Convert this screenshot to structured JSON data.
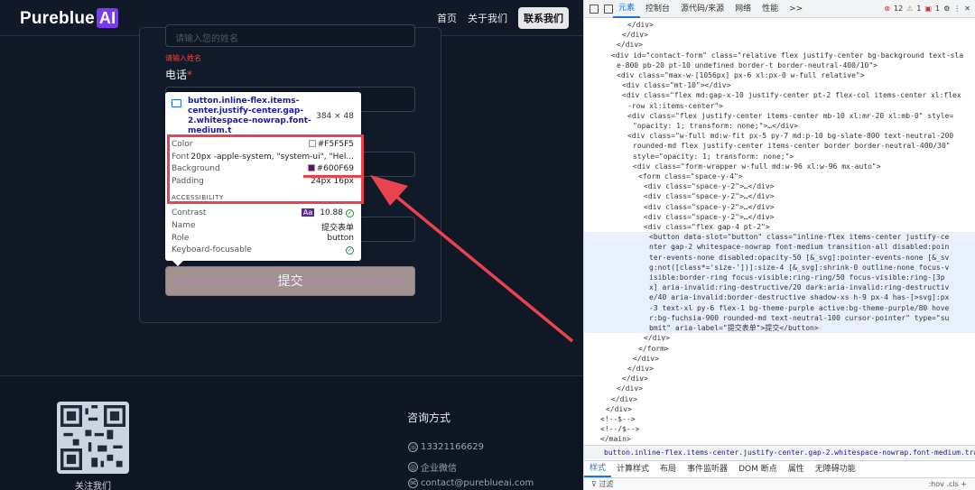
{
  "site": {
    "logo_text": "Pureblue",
    "logo_ai": "AI",
    "nav": {
      "home": "首页",
      "about": "关于我们",
      "contact": "联系我们"
    },
    "form": {
      "name_placeholder": "请输入您的姓名",
      "name_error": "请输入姓名",
      "phone_label": "电话",
      "required_mark": "*",
      "submit_label": "提交"
    },
    "footer": {
      "follow": "关注我们",
      "contact_title": "咨询方式",
      "phone": "13321166629",
      "wechat": "企业微信",
      "email": "contact@pureblueai.com"
    }
  },
  "inspector_tooltip": {
    "selector": "button.inline-flex.items-center.justify-center.gap-2.whitespace-nowrap.font-medium.t",
    "dimensions": "384 × 48",
    "color_label": "Color",
    "color_value": "#F5F5F5",
    "font_label": "Font",
    "font_value": "20px -apple-system, \"system-ui\", \"Hel...",
    "background_label": "Background",
    "background_value": "#600F69",
    "padding_label": "Padding",
    "padding_value": "24px 16px",
    "accessibility_label": "ACCESSIBILITY",
    "contrast_label": "Contrast",
    "contrast_badge": "Aa",
    "contrast_value": "10.88",
    "name_label": "Name",
    "name_value": "提交表单",
    "role_label": "Role",
    "role_value": "button",
    "focus_label": "Keyboard-focusable"
  },
  "devtools": {
    "tabs": [
      "元素",
      "控制台",
      "源代码/来源",
      "网络",
      "性能",
      ">>"
    ],
    "errors": "12",
    "warnings": "1",
    "infos": "1",
    "code_lines": [
      "</div>",
      "</div>",
      "</div>",
      "<div id=\"contact-form\" class=\"relative flex justify-center bg-background text-sla",
      "e-800 pb-20 pt-10 undefined border-t border-neutral-400/10\">",
      "<div class=\"max-w-[1056px] px-6 xl:px-0 w-full relative\">",
      "<div class=\"mt-10\"></div>",
      "<div class=\"flex md:gap-x-10 justify-center pt-2 flex-col items-center xl:flex",
      "-row xl:items-center\">",
      "<div class=\"flex justify-center items-center mb-10 xl:mr-20 xl:mb-0\" style=",
      "\"opacity: 1; transform: none;\">…</div>",
      "<div class=\"w-full md:w-fit px-5 py-7 md:p-10 bg-slate-800 text-neutral-200",
      "rounded-md flex justify-center items-center border border-neutral-400/30\"",
      "style=\"opacity: 1; transform: none;\">",
      "<div class=\"form-wrapper w-full md:w-96 xl:w-96 mx-auto\">",
      "<form class=\"space-y-4\">",
      "<div class=\"space-y-2\">…</div>",
      "<div class=\"space-y-2\">…</div>",
      "<div class=\"space-y-2\">…</div>",
      "<div class=\"space-y-2\">…</div>",
      "<div class=\"flex gap-4 pt-2\">",
      "<button data-slot=\"button\" class=\"inline-flex items-center justify-ce",
      "nter gap-2 whitespace-nowrap font-medium transition-all disabled:poin",
      "ter-events-none disabled:opacity-50 [&_svg]:pointer-events-none [&_sv",
      "g:not([class*='size-'])]:size-4 [&_svg]:shrink-0 outline-none focus-v",
      "isible:border-ring focus-visible:ring-ring/50 focus-visible:ring-[3p",
      "x] aria-invalid:ring-destructive/20 dark:aria-invalid:ring-destructiv",
      "e/40 aria-invalid:border-destructive shadow-xs h-9 px-4 has-[>svg]:px",
      "-3 text-xl py-6 flex-1 bg-theme-purple active:bg-theme-purple/80 hove",
      "r:bg-fuchsia-900 rounded-md text-neutral-100 cursor-pointer\" type=\"su",
      "bmit\" aria-label=\"提交表单\">提交</button>",
      "</div>",
      "</form>",
      "</div>",
      "</div>",
      "</div>",
      "</div>",
      "</div>",
      "</div>",
      "<!--$-->",
      "<!--/$-->",
      "</main>"
    ],
    "breadcrumb": "button.inline-flex.items-center.justify-center.gap-2.whitespace-nowrap.font-medium.transition-all",
    "subtabs": [
      "样式",
      "计算样式",
      "布局",
      "事件监听器",
      "DOM 断点",
      "属性",
      "无障碍功能"
    ],
    "filter_placeholder": "过滤",
    "filter_right": ":hov .cls +"
  }
}
